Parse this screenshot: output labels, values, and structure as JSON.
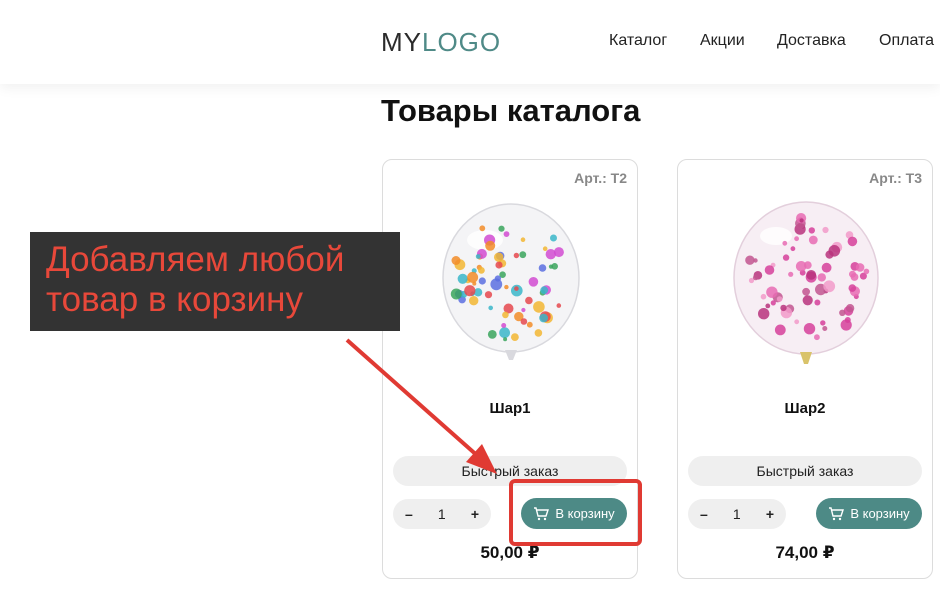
{
  "header": {
    "logo_part1": "MY",
    "logo_part2": "LOGO",
    "nav": [
      "Каталог",
      "Акции",
      "Доставка",
      "Оплата"
    ]
  },
  "page_title": "Товары каталога",
  "products": [
    {
      "sku": "Арт.: Т2",
      "name": "Шар1",
      "quick_order": "Быстрый заказ",
      "qty_minus": "–",
      "qty": "1",
      "qty_plus": "+",
      "add_to_cart": "В корзину",
      "price": "50,00 ₽",
      "confetti": "multicolor"
    },
    {
      "sku": "Арт.: Т3",
      "name": "Шар2",
      "quick_order": "Быстрый заказ",
      "qty_minus": "–",
      "qty": "1",
      "qty_plus": "+",
      "add_to_cart": "В корзину",
      "price": "74,00 ₽",
      "confetti": "pink"
    }
  ],
  "annotation": {
    "text_line1": "Добавляем любой",
    "text_line2": "товар в корзину",
    "color": "#e03a33"
  },
  "colors": {
    "accent": "#4d8a86",
    "annotation_bg": "#333333"
  }
}
